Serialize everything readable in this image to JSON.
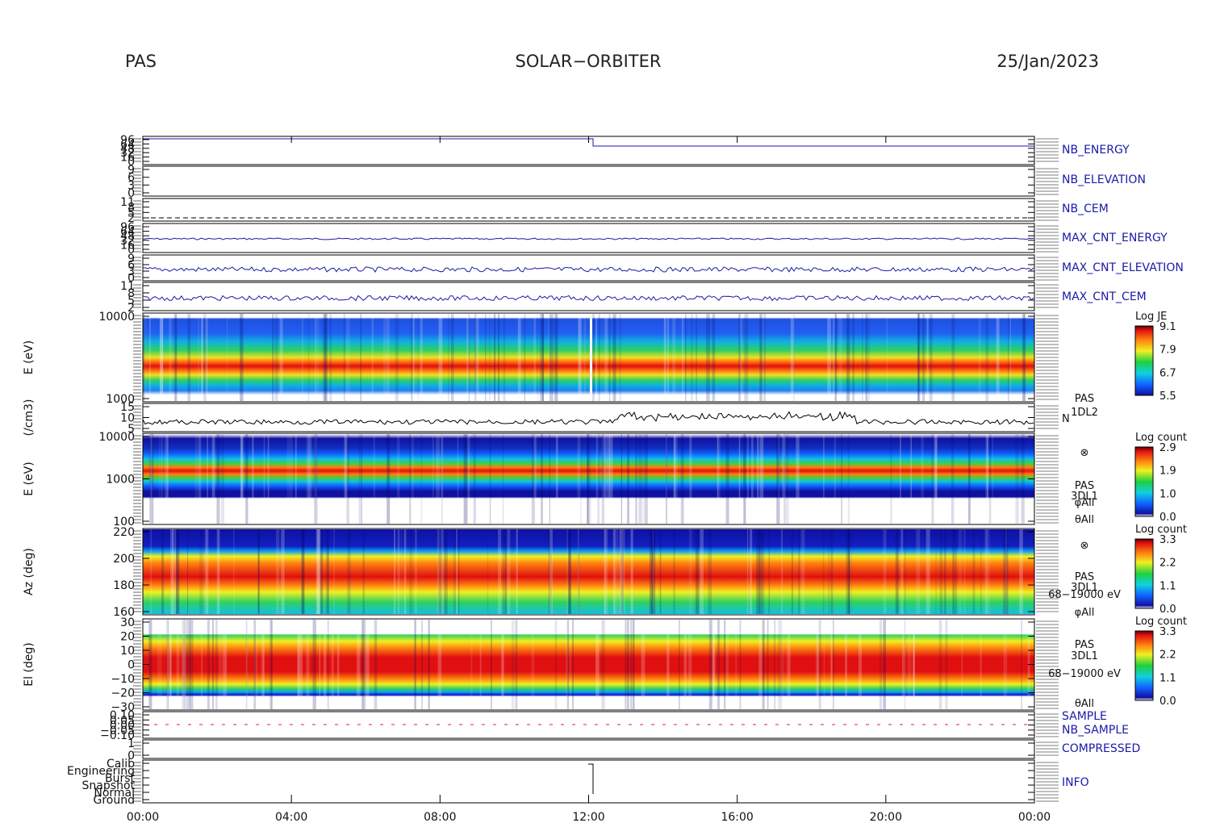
{
  "header": {
    "left": "PAS",
    "center": "SOLAR−ORBITER",
    "right": "25/Jan/2023"
  },
  "chart_data": {
    "type": "spectrogram",
    "x_ticks": [
      "00:00",
      "04:00",
      "08:00",
      "12:00",
      "16:00",
      "20:00",
      "00:00"
    ],
    "colors": {
      "line": "#1a1aa8",
      "red_line": "#e02020",
      "axis": "#000000"
    },
    "panels": [
      {
        "id": "nb_energy",
        "label": "NB_ENERGY",
        "label_color": "#1a1aa8",
        "kind": "line",
        "ticks": [
          "96",
          "64",
          "48",
          "32",
          "16",
          "0"
        ]
      },
      {
        "id": "nb_elevation",
        "label": "NB_ELEVATION",
        "label_color": "#1a1aa8",
        "kind": "line",
        "ticks": [
          "9",
          "6",
          "3",
          "0"
        ]
      },
      {
        "id": "nb_cem",
        "label": "NB_CEM",
        "label_color": "#1a1aa8",
        "kind": "line",
        "ticks": [
          "11",
          "8",
          "5",
          "2"
        ]
      },
      {
        "id": "max_cnt_energy",
        "label": "MAX_CNT_ENERGY",
        "label_color": "#1a1aa8",
        "kind": "line",
        "ticks": [
          "96",
          "64",
          "48",
          "32",
          "16",
          "0"
        ]
      },
      {
        "id": "max_cnt_elevation",
        "label": "MAX_CNT_ELEVATION",
        "label_color": "#1a1aa8",
        "kind": "line",
        "ticks": [
          "9",
          "6",
          "3",
          "0"
        ]
      },
      {
        "id": "max_cnt_cem",
        "label": "MAX_CNT_CEM",
        "label_color": "#1a1aa8",
        "kind": "line",
        "ticks": [
          "11",
          "8",
          "5",
          "2"
        ]
      },
      {
        "id": "e_je",
        "ylabel": "E (eV)",
        "kind": "spectrogram",
        "ticks": [
          "10000",
          "1000"
        ],
        "colorbar": {
          "title": "Log JE",
          "ticks": [
            "9.1",
            "7.9",
            "6.7",
            "5.5"
          ]
        }
      },
      {
        "id": "density",
        "ylabel": "(/cm3)",
        "kind": "line",
        "ticks": [
          "15",
          "10",
          "5"
        ],
        "right_labels": [
          "PAS",
          "1DL2",
          "N"
        ]
      },
      {
        "id": "e_count",
        "ylabel": "E (eV)",
        "kind": "spectrogram",
        "ticks": [
          "10000",
          "1000",
          "100"
        ],
        "right_labels": [
          "⊗",
          "PAS",
          "3DL1",
          "φAll",
          "θAll"
        ],
        "colorbar": {
          "title": "Log count",
          "ticks": [
            "2.9",
            "1.9",
            "1.0",
            "0.0"
          ]
        }
      },
      {
        "id": "azimuth",
        "ylabel": "Az (deg)",
        "kind": "spectrogram",
        "ticks": [
          "220",
          "200",
          "180",
          "160"
        ],
        "right_labels": [
          "⊗",
          "PAS",
          "3DL1",
          "68−19000 eV",
          "φAll"
        ],
        "colorbar": {
          "title": "Log count",
          "ticks": [
            "3.3",
            "2.2",
            "1.1",
            "0.0"
          ]
        }
      },
      {
        "id": "elevation",
        "ylabel": "El (deg)",
        "kind": "spectrogram",
        "ticks": [
          "30",
          "20",
          "10",
          "0",
          "−10",
          "−20",
          "−30"
        ],
        "right_labels": [
          "PAS",
          "3DL1",
          "68−19000 eV",
          "θAll"
        ],
        "colorbar": {
          "title": "Log count",
          "ticks": [
            "3.3",
            "2.2",
            "1.1",
            "0.0"
          ]
        }
      },
      {
        "id": "sample",
        "labels": [
          "SAMPLE",
          "NB_SAMPLE"
        ],
        "label_colors": [
          "#1a1aa8",
          "#e02020"
        ],
        "kind": "line",
        "ticks": [
          "0.10",
          "0.05",
          "0.00",
          "−0.05",
          "−0.10"
        ]
      },
      {
        "id": "compressed",
        "label": "COMPRESSED",
        "label_color": "#1a1aa8",
        "kind": "line",
        "ticks": [
          "1",
          "0"
        ]
      },
      {
        "id": "info",
        "label": "INFO",
        "label_color": "#1a1aa8",
        "kind": "line",
        "ticks": [
          "Calib",
          "Engineering",
          "Burst",
          "Snapshot",
          "Normal",
          "Ground"
        ]
      }
    ]
  }
}
